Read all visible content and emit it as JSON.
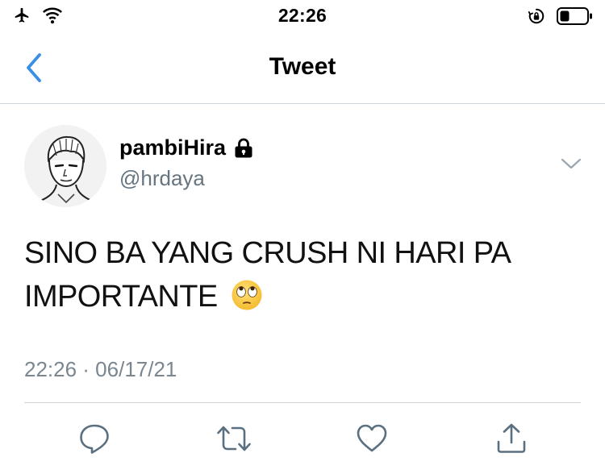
{
  "status_bar": {
    "time": "22:26",
    "left_icons": [
      "airplane-icon",
      "wifi-icon"
    ],
    "right_icons": [
      "orientation-lock-icon",
      "battery-icon"
    ]
  },
  "nav": {
    "title": "Tweet",
    "back_icon": "chevron-left-icon",
    "accent_color": "#3a8ee6"
  },
  "tweet": {
    "display_name": "pambiHira",
    "protected_icon": "lock-icon",
    "handle": "@hrdaya",
    "text": "SINO BA YANG CRUSH NI HARI PA IMPORTANTE",
    "emoji": "face-with-rolling-eyes",
    "timestamp": "22:26 · 06/17/21"
  },
  "actions": [
    "reply-icon",
    "retweet-icon",
    "like-icon",
    "share-icon"
  ],
  "colors": {
    "secondary_text": "#66757f",
    "divider": "#cfd6dc",
    "action_icon": "#5a7080"
  }
}
